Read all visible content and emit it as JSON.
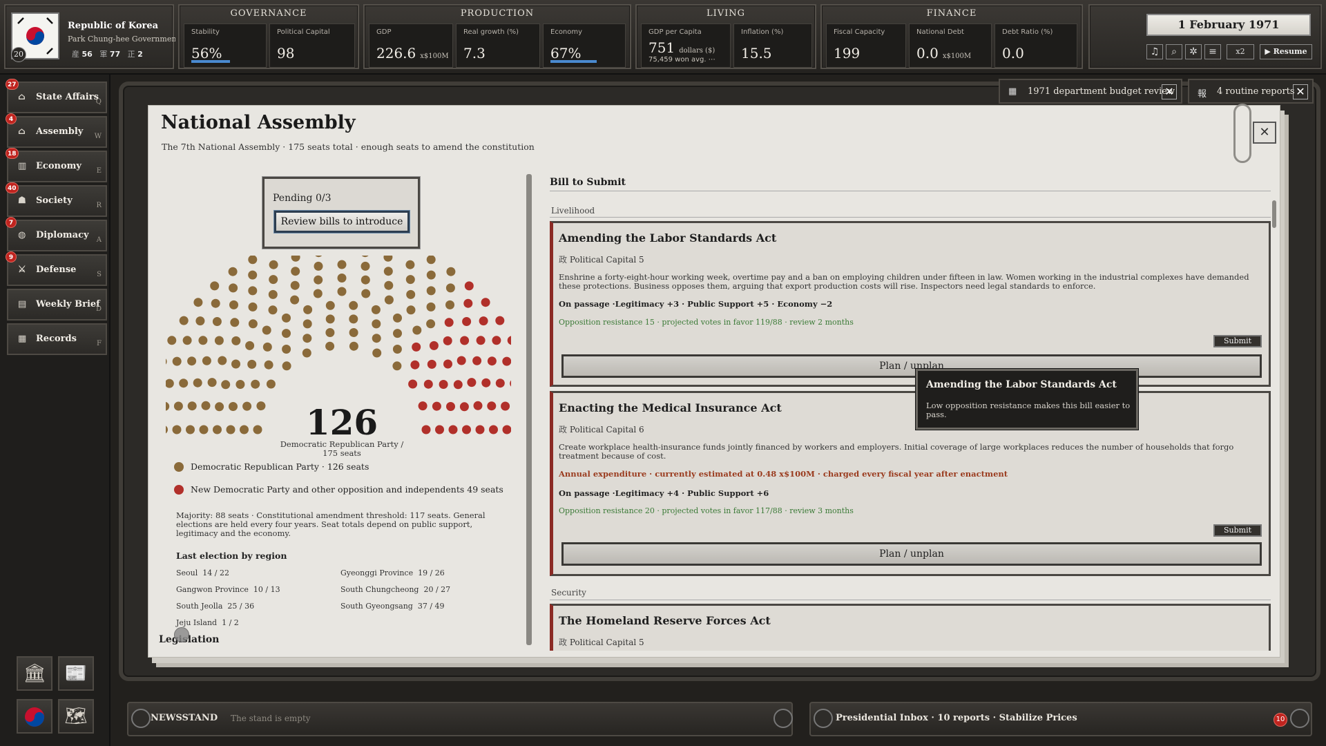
{
  "country": {
    "name": "Republic of Korea",
    "government": "Park Chung-hee Government",
    "year_badge": "20",
    "stat1": "56",
    "stat2": "77",
    "stat3": "2",
    "icon1": "産",
    "icon2": "軍",
    "icon3": "正"
  },
  "governance": {
    "title": "GOVERNANCE",
    "stability_label": "Stability",
    "stability": "56%",
    "stability_level": 0.56,
    "capital_label": "Political Capital",
    "capital": "98"
  },
  "production": {
    "title": "PRODUCTION",
    "gdp_label": "GDP",
    "gdp": "226.6",
    "gdp_unit": "x$100M",
    "growth_label": "Real growth (%)",
    "growth": "7.3",
    "economy_label": "Economy",
    "economy": "67%",
    "economy_level": 0.67
  },
  "living": {
    "title": "LIVING",
    "gdppc_label": "GDP per Capita",
    "gdppc": "751",
    "gdppc_unit": "dollars ($)",
    "gdppc_sub": "75,459 won avg. ⋯",
    "inflation_label": "Inflation (%)",
    "inflation": "15.5"
  },
  "finance": {
    "title": "FINANCE",
    "fiscal_label": "Fiscal Capacity",
    "fiscal": "199",
    "debt_label": "National Debt",
    "debt": "0.0",
    "debt_unit": "x$100M",
    "ratio_label": "Debt Ratio (%)",
    "ratio": "0.0"
  },
  "date": {
    "value": "1 February 1971",
    "speed": "x2",
    "resume": "▶ Resume"
  },
  "nav": [
    {
      "label": "State Affairs",
      "key": "Q",
      "badge": "27",
      "icon": "⌂"
    },
    {
      "label": "Assembly",
      "key": "W",
      "badge": "4",
      "icon": "⌂"
    },
    {
      "label": "Economy",
      "key": "E",
      "badge": "18",
      "icon": "▥"
    },
    {
      "label": "Society",
      "key": "R",
      "badge": "40",
      "icon": "☗"
    },
    {
      "label": "Diplomacy",
      "key": "A",
      "badge": "7",
      "icon": "◍"
    },
    {
      "label": "Defense",
      "key": "S",
      "badge": "9",
      "icon": "⚔"
    },
    {
      "label": "Weekly Brief",
      "key": "D",
      "badge": "",
      "icon": "▤"
    },
    {
      "label": "Records",
      "key": "F",
      "badge": "",
      "icon": "▦"
    }
  ],
  "tabs": [
    {
      "icon": "▦",
      "label": "1971 department budget review"
    },
    {
      "icon": "報",
      "label": "4 routine reports"
    }
  ],
  "assembly": {
    "title": "National Assembly",
    "subtitle": "The 7th National Assembly · 175 seats total · enough seats to amend the constitution",
    "pending": "Pending 0/3",
    "review_button": "Review bills to introduce",
    "seat_count": "126",
    "seat_caption": "Democratic Republican Party / 175 seats",
    "legend": [
      {
        "label": "Democratic Republican Party · 126 seats",
        "color": "#8a6a3a"
      },
      {
        "label": "New Democratic Party and other opposition and independents 49 seats",
        "color": "#b1302a"
      }
    ],
    "majority_text": "Majority: 88 seats · Constitutional amendment threshold: 117 seats. General elections are held every four years. Seat totals depend on public support, legitimacy and the economy.",
    "region_title": "Last election by region",
    "regions": [
      {
        "name": "Seoul",
        "seats": "14 / 22"
      },
      {
        "name": "Gyeonggi Province",
        "seats": "19 / 26"
      },
      {
        "name": "Gangwon Province",
        "seats": "10 / 13"
      },
      {
        "name": "South Chungcheong",
        "seats": "20 / 27"
      },
      {
        "name": "South Jeolla",
        "seats": "25 / 36"
      },
      {
        "name": "South Gyeongsang",
        "seats": "37 / 49"
      },
      {
        "name": "Jeju Island",
        "seats": "1 / 2"
      }
    ],
    "legislation_label": "Legislation"
  },
  "bills": {
    "heading": "Bill to Submit",
    "category1": "Livelihood",
    "category2": "Security",
    "cap_icon": "政",
    "submit_label": "Submit",
    "plan_label": "Plan / unplan",
    "labor": {
      "title": "Amending the Labor Standards Act",
      "capital": "Political Capital 5",
      "desc": "Enshrine a forty-eight-hour working week, overtime pay and a ban on employing children under fifteen in law. Women working in the industrial complexes have demanded these protections. Business opposes them, arguing that export production costs will rise. Inspectors need legal standards to enforce.",
      "passage": "On passage ·Legitimacy +3 · Public Support +5 · Economy −2",
      "opposition": "Opposition resistance 15 · projected votes in favor 119/88 · review 2 months"
    },
    "medical": {
      "title": "Enacting the Medical Insurance Act",
      "capital": "Political Capital 6",
      "desc": "Create workplace health-insurance funds jointly financed by workers and employers. Initial coverage of large workplaces reduces the number of households that forgo treatment because of cost.",
      "expenditure": "Annual expenditure · currently estimated at 0.48 x$100M · charged every fiscal year after enactment",
      "passage": "On passage ·Legitimacy +4 · Public Support +6",
      "opposition": "Opposition resistance 20 · projected votes in favor 117/88 · review 3 months"
    },
    "reserve": {
      "title": "The Homeland Reserve Forces Act",
      "capital": "Political Capital 5"
    }
  },
  "tooltip": {
    "title": "Amending the Labor Standards Act",
    "text": "Low opposition resistance makes this bill easier to pass."
  },
  "newsstand": {
    "label": "NEWSSTAND",
    "text": "The stand is empty"
  },
  "inbox": {
    "text": "Presidential Inbox · 10 reports · Stabilize Prices",
    "badge": "10"
  },
  "chart_data": {
    "type": "parliament",
    "total": 175,
    "series": [
      {
        "name": "Democratic Republican Party",
        "values": [
          126
        ],
        "color": "#8a6a3a"
      },
      {
        "name": "New Democratic Party and other opposition and independents",
        "values": [
          49
        ],
        "color": "#b1302a"
      }
    ]
  }
}
